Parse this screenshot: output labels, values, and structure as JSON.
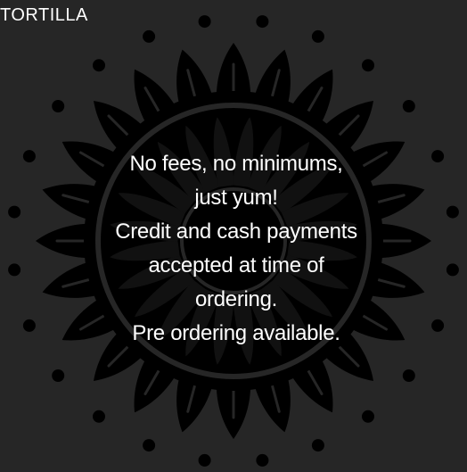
{
  "brand": {
    "name": "TORTILLA"
  },
  "decoration": {
    "icon": "mandala-flower-medallion",
    "color": "#000000",
    "background": "#262626"
  },
  "message": {
    "lines": [
      "No fees, no minimums,",
      "just yum!",
      "Credit and cash payments",
      "accepted at time of",
      "ordering.",
      "Pre ordering available."
    ]
  }
}
